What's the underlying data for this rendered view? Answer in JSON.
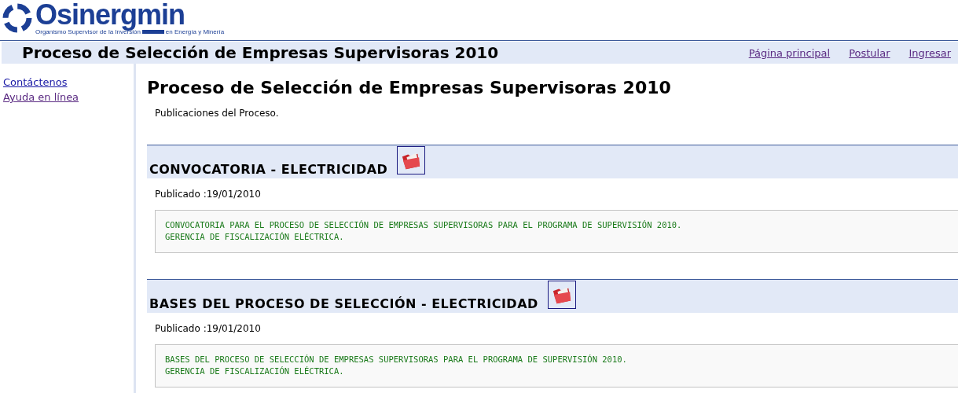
{
  "logo": {
    "name": "Osinergmin",
    "subtitle_left": "Organismo Supervisor de la Inversión",
    "subtitle_right": "en Energía y Minería"
  },
  "title_bar": {
    "title": "Proceso de Selección de Empresas Supervisoras 2010",
    "links": [
      {
        "label": "Página principal"
      },
      {
        "label": "Postular"
      },
      {
        "label": "Ingresar"
      }
    ]
  },
  "sidebar": {
    "links": [
      {
        "label": "Contáctenos",
        "visited": false
      },
      {
        "label": "Ayuda en línea",
        "visited": true
      }
    ]
  },
  "main": {
    "heading": "Proceso de Selección de Empresas Supervisoras 2010",
    "intro": "Publicaciones del Proceso.",
    "publications": [
      {
        "title": "CONVOCATORIA - ELECTRICIDAD",
        "published": "Publicado :19/01/2010",
        "lines": [
          "CONVOCATORIA PARA EL PROCESO DE SELECCIÓN DE EMPRESAS SUPERVISORAS PARA EL PROGRAMA DE SUPERVISIÓN 2010.",
          "GERENCIA DE FISCALIZACIÓN ELÉCTRICA."
        ]
      },
      {
        "title": "BASES DEL PROCESO DE SELECCIÓN - ELECTRICIDAD",
        "published": "Publicado :19/01/2010",
        "lines": [
          "BASES DEL PROCESO DE SELECCIÓN DE EMPRESAS SUPERVISORAS PARA EL PROGRAMA DE SUPERVISIÓN 2010.",
          "GERENCIA DE FISCALIZACIÓN ELÉCTRICA."
        ]
      }
    ]
  }
}
